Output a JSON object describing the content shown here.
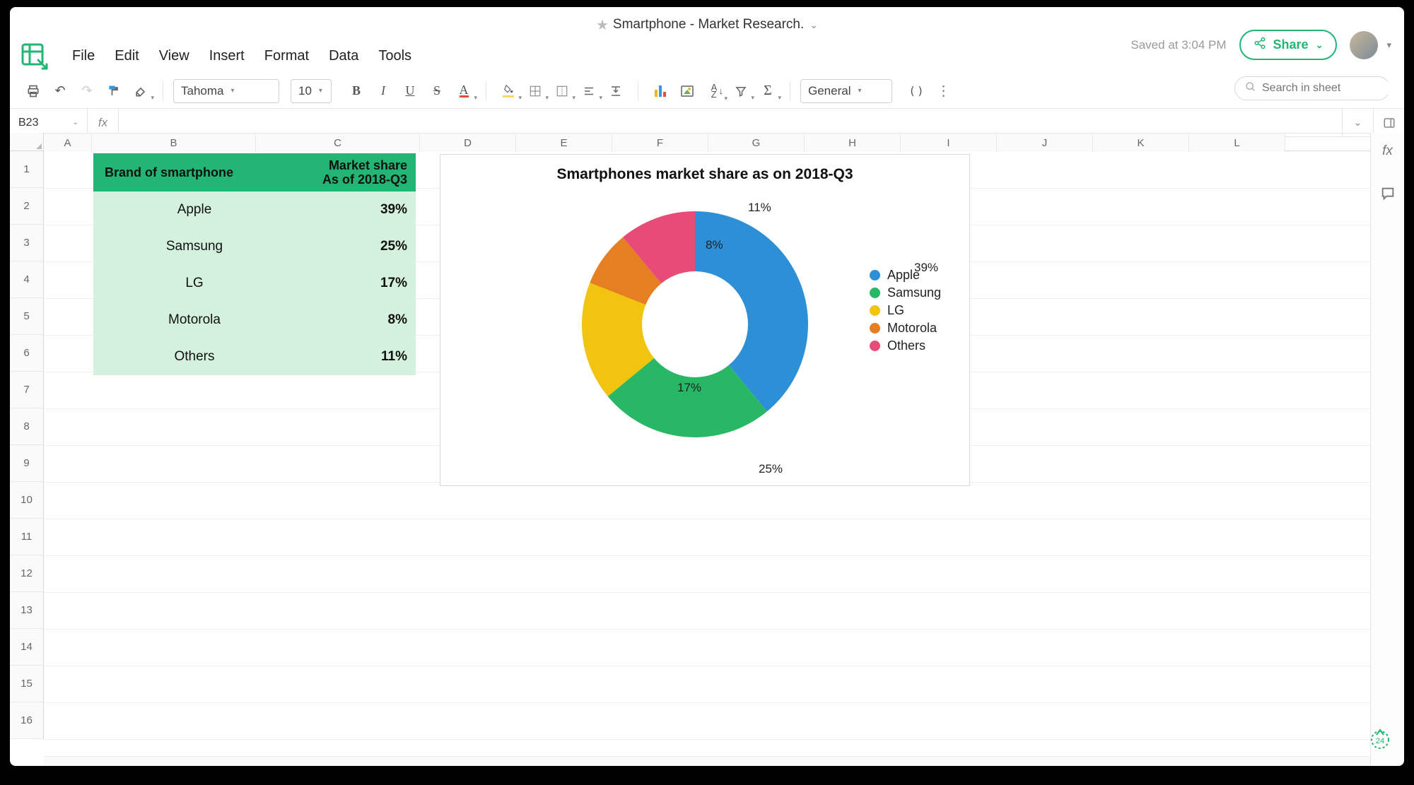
{
  "title": {
    "document_name": "Smartphone - Market Research.",
    "saved_text": "Saved at 3:04 PM",
    "share_label": "Share"
  },
  "menu": {
    "file": "File",
    "edit": "Edit",
    "view": "View",
    "insert": "Insert",
    "format": "Format",
    "data": "Data",
    "tools": "Tools"
  },
  "toolbar": {
    "font": "Tahoma",
    "font_size": "10",
    "number_format": "General",
    "search_placeholder": "Search in sheet"
  },
  "namebox": {
    "cell_ref": "B23"
  },
  "columns": {
    "widths": [
      68,
      232,
      232,
      136,
      136,
      136,
      136,
      136,
      136,
      136,
      136,
      136
    ],
    "labels": [
      "A",
      "B",
      "C",
      "D",
      "E",
      "F",
      "G",
      "H",
      "I",
      "J",
      "K",
      "L"
    ]
  },
  "rows": {
    "count": 16
  },
  "table": {
    "header": {
      "col1": "Brand of smartphone",
      "col2_line1": "Market share",
      "col2_line2": "As of 2018-Q3"
    },
    "rows": [
      {
        "brand": "Apple",
        "share": "39%"
      },
      {
        "brand": "Samsung",
        "share": "25%"
      },
      {
        "brand": "LG",
        "share": "17%"
      },
      {
        "brand": "Motorola",
        "share": "8%"
      },
      {
        "brand": "Others",
        "share": "11%"
      }
    ]
  },
  "chart_data": {
    "type": "pie",
    "title": "Smartphones market share as on 2018-Q3",
    "series": [
      {
        "name": "Apple",
        "value": 39,
        "label": "39%",
        "color": "#2d8fd5"
      },
      {
        "name": "Samsung",
        "value": 25,
        "label": "25%",
        "color": "#28b765"
      },
      {
        "name": "LG",
        "value": 17,
        "label": "17%",
        "color": "#f1c40f"
      },
      {
        "name": "Motorola",
        "value": 8,
        "label": "8%",
        "color": "#e67e22"
      },
      {
        "name": "Others",
        "value": 11,
        "label": "11%",
        "color": "#e84b78"
      }
    ],
    "donut_inner_ratio": 0.42,
    "legend_position": "right"
  }
}
